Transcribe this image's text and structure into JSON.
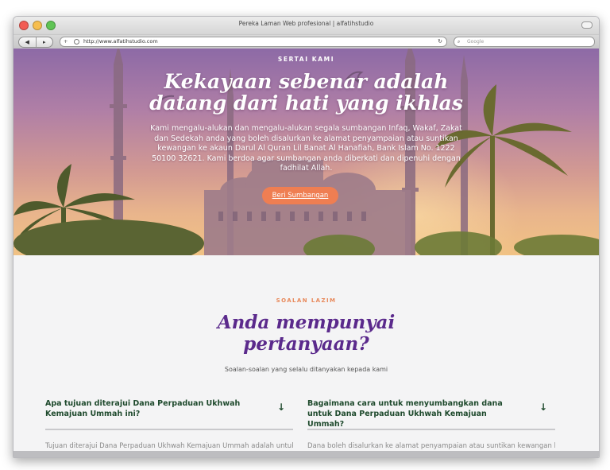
{
  "browser": {
    "window_title": "Pereka Laman Web profesional | alfatihstudio",
    "url": "http://www.alfatihstudio.com",
    "search_placeholder": "Google"
  },
  "hero": {
    "kicker": "SERTAI KAMI",
    "title": "Kekayaan sebenar adalah datang dari hati yang ikhlas",
    "text": "Kami mengalu-alukan dan mengalu-alukan segala sumbangan Infaq, Wakaf, Zakat dan Sedekah anda yang boleh disalurkan ke alamat penyampaian atau suntikan kewangan ke akaun Darul Al Quran Lil Banat Al Hanafiah, Bank Islam No. 1222 50100 32621. Kami berdoa agar sumbangan anda diberkati dan dipenuhi dengan fadhilat Allah.",
    "button_label": "Beri Sumbangan",
    "button_color": "#ef7e52"
  },
  "faq": {
    "kicker": "SOALAN LAZIM",
    "title": "Anda mempunyai pertanyaan?",
    "subtitle": "Soalan-soalan yang selalu ditanyakan kepada kami",
    "items": [
      {
        "question": "Apa tujuan diterajui Dana Perpaduan Ukhwah Kemajuan Ummah ini?",
        "answer": "Tujuan diterajui Dana Perpaduan Ukhwah Kemajuan Ummah adalah untuk",
        "icon": "arrow-down-icon"
      },
      {
        "question": "Bagaimana cara untuk menyumbangkan dana untuk Dana Perpaduan Ukhwah Kemajuan Ummah?",
        "answer": "Dana boleh disalurkan ke alamat penyampaian atau suntikan kewangan ke",
        "icon": "arrow-down-icon"
      }
    ],
    "accent_color": "#5b2a8c",
    "question_color": "#1f4a2d"
  }
}
